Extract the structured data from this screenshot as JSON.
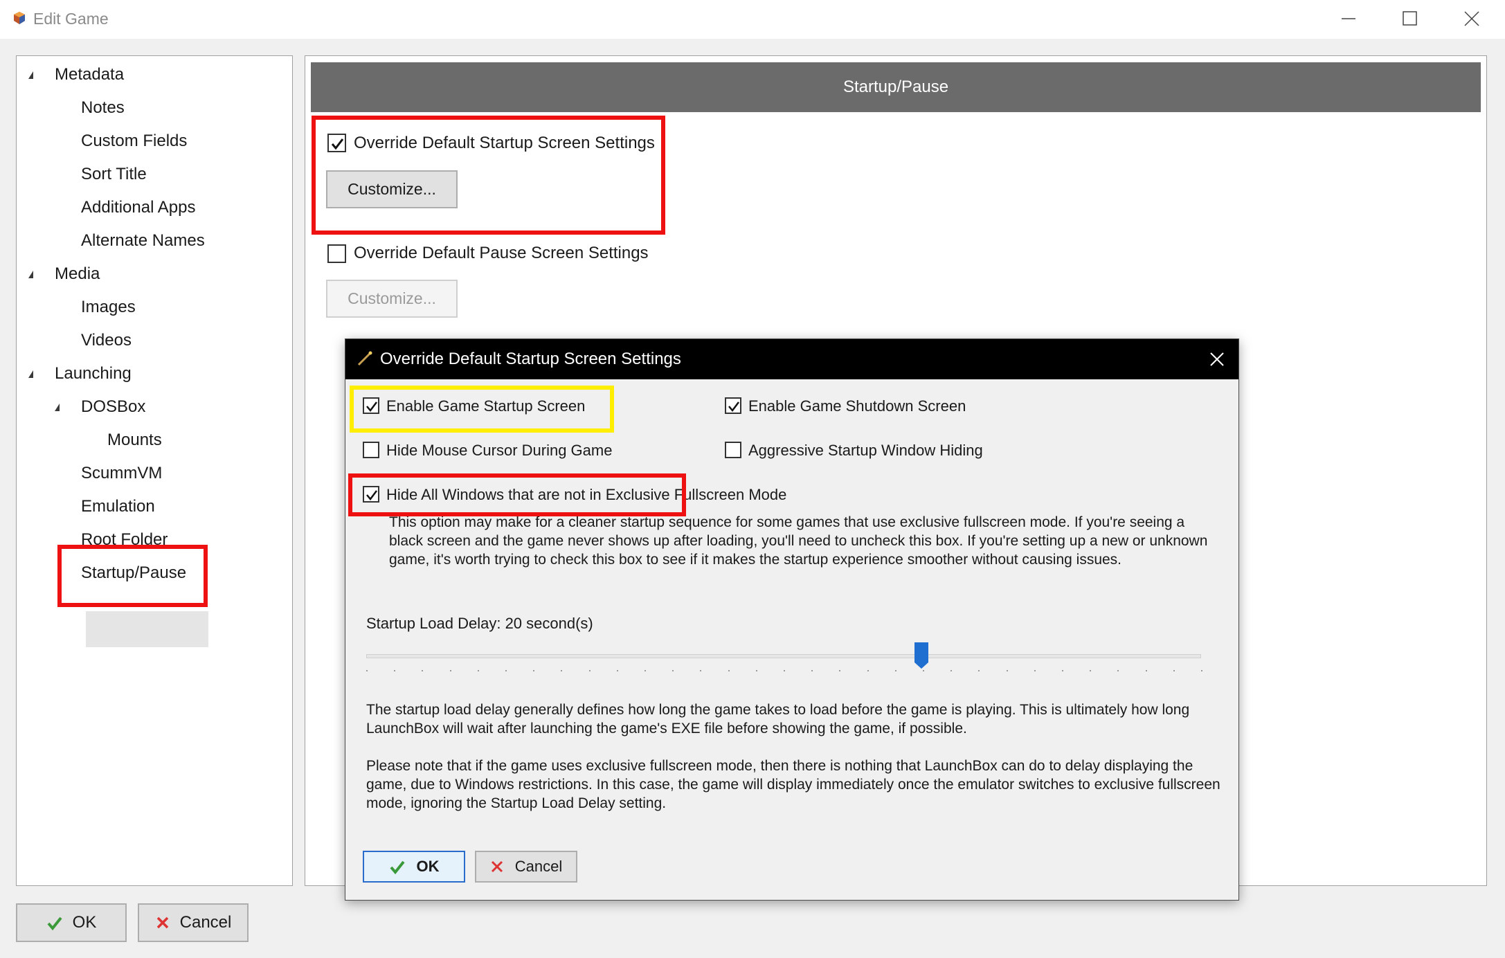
{
  "window": {
    "title": "Edit Game"
  },
  "tree": {
    "items": [
      {
        "label": "Metadata"
      },
      {
        "label": "Notes"
      },
      {
        "label": "Custom Fields"
      },
      {
        "label": "Sort Title"
      },
      {
        "label": "Additional Apps"
      },
      {
        "label": "Alternate Names"
      },
      {
        "label": "Media"
      },
      {
        "label": "Images"
      },
      {
        "label": "Videos"
      },
      {
        "label": "Launching"
      },
      {
        "label": "DOSBox"
      },
      {
        "label": "Mounts"
      },
      {
        "label": "ScummVM"
      },
      {
        "label": "Emulation"
      },
      {
        "label": "Root Folder"
      },
      {
        "label": "Startup/Pause"
      }
    ],
    "selected": "Startup/Pause"
  },
  "section": {
    "header": "Startup/Pause",
    "override_startup_label": "Override Default Startup Screen Settings",
    "override_startup_checked": true,
    "customize_startup_label": "Customize...",
    "override_pause_label": "Override Default Pause Screen Settings",
    "override_pause_checked": false,
    "customize_pause_label": "Customize..."
  },
  "bottom": {
    "ok_label": "OK",
    "cancel_label": "Cancel"
  },
  "dialog": {
    "title": "Override Default Startup Screen Settings",
    "enable_startup_label": "Enable Game Startup Screen",
    "enable_startup_checked": true,
    "enable_shutdown_label": "Enable Game Shutdown Screen",
    "enable_shutdown_checked": true,
    "hide_cursor_label": "Hide Mouse Cursor During Game",
    "hide_cursor_checked": false,
    "aggressive_label": "Aggressive Startup Window Hiding",
    "aggressive_checked": false,
    "hide_windows_label": "Hide All Windows that are not in Exclusive Fullscreen Mode",
    "hide_windows_checked": true,
    "hide_windows_desc": "This option may make for a cleaner startup sequence for some games that use exclusive fullscreen mode. If you're seeing a black screen and the game never shows up after loading, you'll need to uncheck this box. If you're setting up a new or unknown game, it's worth trying to check this box to see if it makes the startup experience smoother without causing issues.",
    "delay_label": "Startup Load Delay: 20 second(s)",
    "delay_value": 20,
    "delay_slider_fraction": 0.665,
    "delay_desc_1": "The startup load delay generally defines how long the game takes to load before the game is playing. This is ultimately how long LaunchBox will wait after launching the game's EXE file before showing the game, if possible.",
    "delay_desc_2": "Please note that if the game uses exclusive fullscreen mode, then there is nothing that LaunchBox can do to delay displaying the game, due to Windows restrictions. In this case, the game will display immediately once the emulator switches to exclusive fullscreen mode, ignoring the Startup Load Delay setting.",
    "ok_label": "OK",
    "cancel_label": "Cancel"
  },
  "colors": {
    "highlight_red": "#ee1111",
    "highlight_yellow": "#ffee00",
    "header_gray": "#6b6b6b",
    "slider_blue": "#1f6fd1"
  }
}
